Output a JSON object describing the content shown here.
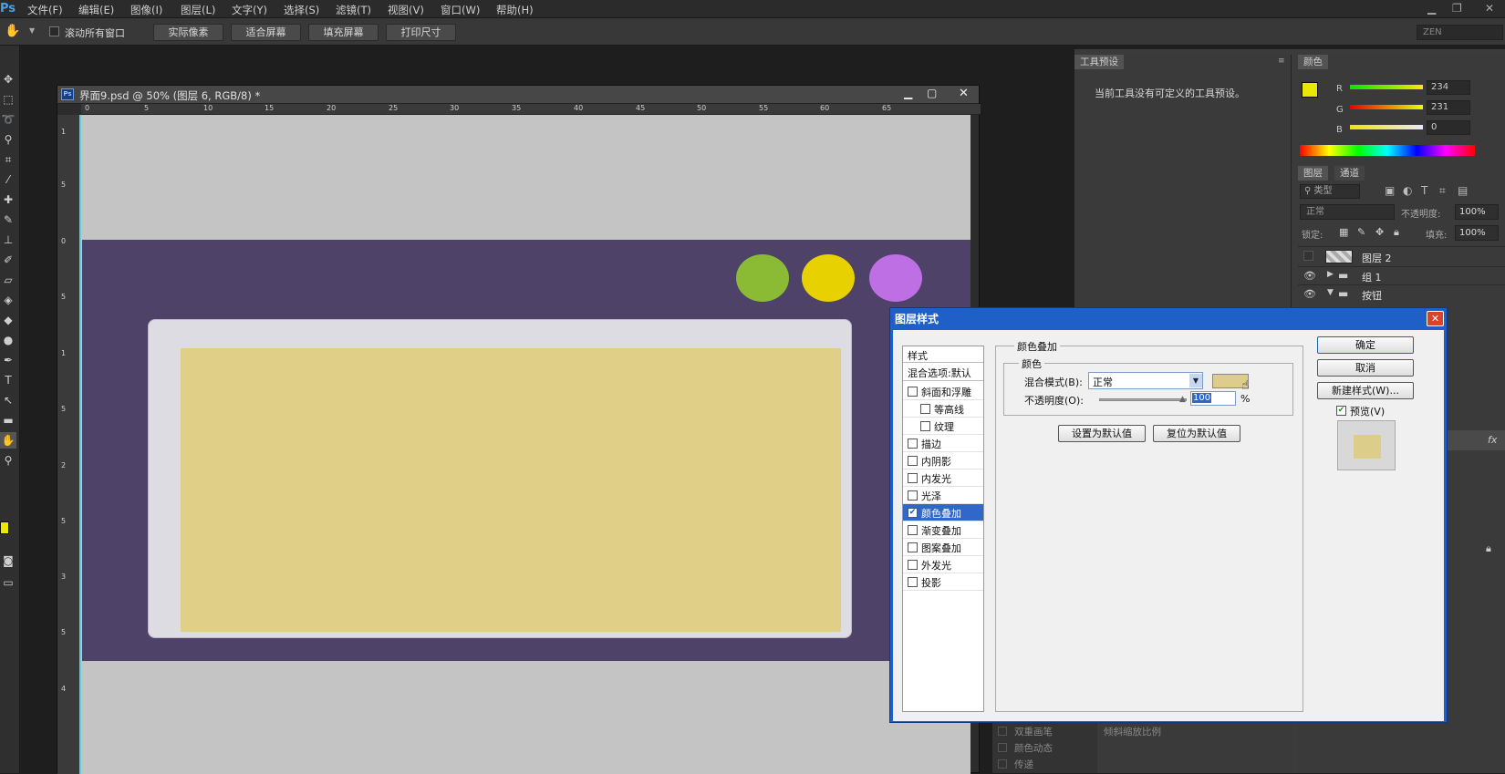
{
  "menubar": {
    "logo": "Ps",
    "items": [
      "文件(F)",
      "编辑(E)",
      "图像(I)",
      "图层(L)",
      "文字(Y)",
      "选择(S)",
      "滤镜(T)",
      "视图(V)",
      "窗口(W)",
      "帮助(H)"
    ]
  },
  "optionsbar": {
    "scroll_all_label": "滚动所有窗口",
    "buttons": [
      "实际像素",
      "适合屏幕",
      "填充屏幕",
      "打印尺寸"
    ],
    "workspace": "ZEN"
  },
  "document": {
    "title": "界面9.psd @ 50% (图层 6, RGB/8) *",
    "hruler_ticks": [
      "0",
      "5",
      "10",
      "15",
      "20",
      "25",
      "30",
      "35",
      "40",
      "45",
      "50",
      "55",
      "60",
      "65"
    ],
    "vruler_ticks": [
      "1",
      "5",
      "0",
      "5",
      "1",
      "5",
      "2",
      "5",
      "3",
      "5",
      "4"
    ],
    "circle_colors": [
      "#8bbb35",
      "#e8d100",
      "#bd6fe3"
    ],
    "band_color": "#4e4268",
    "card_fill": "#dfcf87"
  },
  "tool_presets": {
    "tab": "工具预设",
    "message": "当前工具没有可定义的工具预设。"
  },
  "color_panel": {
    "tab": "颜色",
    "r_label": "R",
    "g_label": "G",
    "b_label": "B",
    "r": "234",
    "g": "231",
    "b": "0",
    "fg_color": "#eae700"
  },
  "layers_panel": {
    "tabs": [
      "图层",
      "通道"
    ],
    "filter": "类型",
    "blend_mode": "正常",
    "opacity_label": "不透明度:",
    "opacity": "100%",
    "lock_label": "锁定:",
    "fill_label": "填充:",
    "fill": "100%",
    "layers": [
      {
        "name": "图层 2"
      },
      {
        "name": "组 1"
      },
      {
        "name": "按钮"
      }
    ]
  },
  "brush_panel": {
    "rows": [
      "双重画笔",
      "颜色动态",
      "传递"
    ],
    "tilt_label": "倾斜缩放比例"
  },
  "dialog": {
    "title": "图层样式",
    "styles_header": "样式",
    "blend_options": "混合选项:默认",
    "style_items": [
      {
        "label": "斜面和浮雕",
        "indent": false,
        "checked": false
      },
      {
        "label": "等高线",
        "indent": true,
        "checked": false
      },
      {
        "label": "纹理",
        "indent": true,
        "checked": false
      },
      {
        "label": "描边",
        "indent": false,
        "checked": false
      },
      {
        "label": "内阴影",
        "indent": false,
        "checked": false
      },
      {
        "label": "内发光",
        "indent": false,
        "checked": false
      },
      {
        "label": "光泽",
        "indent": false,
        "checked": false
      },
      {
        "label": "颜色叠加",
        "indent": false,
        "checked": true
      },
      {
        "label": "渐变叠加",
        "indent": false,
        "checked": false
      },
      {
        "label": "图案叠加",
        "indent": false,
        "checked": false
      },
      {
        "label": "外发光",
        "indent": false,
        "checked": false
      },
      {
        "label": "投影",
        "indent": false,
        "checked": false
      }
    ],
    "section_title": "颜色叠加",
    "group_title": "颜色",
    "blend_mode_label": "混合模式(B):",
    "blend_mode_value": "正常",
    "opacity_label": "不透明度(O):",
    "opacity_value": "100",
    "percent": "%",
    "overlay_color": "#dccd8a",
    "set_default": "设置为默认值",
    "reset_default": "复位为默认值",
    "ok": "确定",
    "cancel": "取消",
    "new_style": "新建样式(W)...",
    "preview_label": "预览(V)"
  }
}
